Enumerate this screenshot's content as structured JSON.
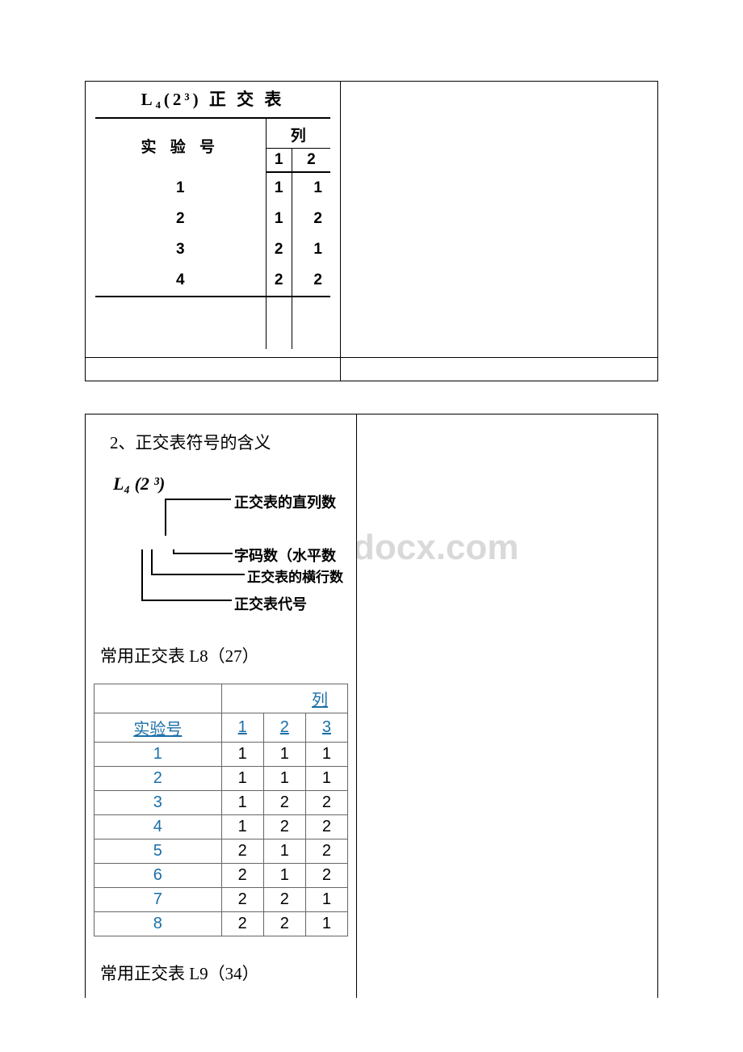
{
  "figure1": {
    "title": "L₄(2³) 正 交 表",
    "rowHeader": "实 验 号",
    "colHeader": "列",
    "colLabels": [
      "1",
      "2"
    ],
    "rows": [
      {
        "no": "1",
        "c1": "1",
        "c2": "1"
      },
      {
        "no": "2",
        "c1": "1",
        "c2": "2"
      },
      {
        "no": "3",
        "c1": "2",
        "c2": "1"
      },
      {
        "no": "4",
        "c1": "2",
        "c2": "2"
      }
    ]
  },
  "section2": {
    "heading": "2、正交表符号的含义",
    "notation": "L₄ (2 ³)",
    "labels": {
      "columns": "正交表的直列数",
      "levels": "字码数（水平数",
      "rows": "正交表的横行数",
      "code": "正交表代号"
    },
    "l8_title": "常用正交表 L8（27）",
    "l8_table": {
      "rowHeader": "实验号",
      "colHeader": "列",
      "cols": [
        "1",
        "2",
        "3"
      ],
      "rows": [
        {
          "no": "1",
          "c": [
            "1",
            "1",
            "1"
          ]
        },
        {
          "no": "2",
          "c": [
            "1",
            "1",
            "1"
          ]
        },
        {
          "no": "3",
          "c": [
            "1",
            "2",
            "2"
          ]
        },
        {
          "no": "4",
          "c": [
            "1",
            "2",
            "2"
          ]
        },
        {
          "no": "5",
          "c": [
            "2",
            "1",
            "2"
          ]
        },
        {
          "no": "6",
          "c": [
            "2",
            "1",
            "2"
          ]
        },
        {
          "no": "7",
          "c": [
            "2",
            "2",
            "1"
          ]
        },
        {
          "no": "8",
          "c": [
            "2",
            "2",
            "1"
          ]
        }
      ]
    },
    "l9_title": "常用正交表 L9（34）"
  },
  "watermark": "docx.com"
}
